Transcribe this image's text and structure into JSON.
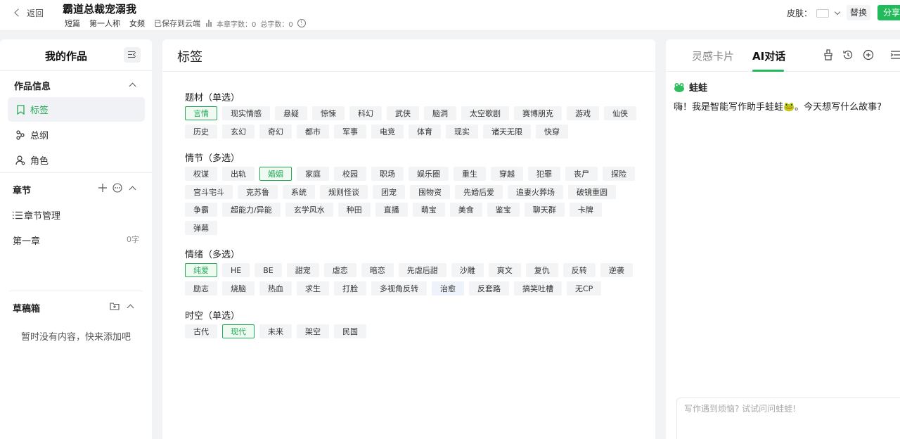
{
  "header": {
    "back_label": "返回",
    "title": "霸道总裁宠溺我",
    "tags": [
      "短篇",
      "第一人称",
      "女频"
    ],
    "saved_status": "已保存到云端",
    "chapter_count_label": "本章字数：0",
    "total_count_label": "总字数：0",
    "skin_label": "皮肤：",
    "replace_label": "替换",
    "share_label": "分享"
  },
  "sidebar": {
    "title": "我的作品",
    "work_info_title": "作品信息",
    "items": [
      {
        "label": "标签",
        "icon": "bookmark-icon",
        "active": true
      },
      {
        "label": "总纲",
        "icon": "outline-icon",
        "active": false
      },
      {
        "label": "角色",
        "icon": "person-icon",
        "active": false
      }
    ],
    "chapters_title": "章节",
    "chapter_manage_label": "章节管理",
    "chapters": [
      {
        "name": "第一章",
        "words": "0字"
      }
    ],
    "drafts_title": "草稿箱",
    "drafts_empty": "暂时没有内容，快来添加吧"
  },
  "main": {
    "title": "标签",
    "groups": [
      {
        "title": "题材（单选）",
        "rows": [
          [
            {
              "t": "言情",
              "s": true
            },
            {
              "t": "现实情感"
            },
            {
              "t": "悬疑"
            },
            {
              "t": "惊悚"
            },
            {
              "t": "科幻"
            },
            {
              "t": "武侠"
            },
            {
              "t": "脑洞"
            },
            {
              "t": "太空歌剧"
            },
            {
              "t": "赛博朋克"
            },
            {
              "t": "游戏"
            },
            {
              "t": "仙侠"
            }
          ],
          [
            {
              "t": "历史"
            },
            {
              "t": "玄幻"
            },
            {
              "t": "奇幻"
            },
            {
              "t": "都市"
            },
            {
              "t": "军事"
            },
            {
              "t": "电竞"
            },
            {
              "t": "体育"
            },
            {
              "t": "现实"
            },
            {
              "t": "诸天无限"
            },
            {
              "t": "快穿"
            }
          ]
        ]
      },
      {
        "title": "情节（多选）",
        "rows": [
          [
            {
              "t": "权谋"
            },
            {
              "t": "出轨"
            },
            {
              "t": "婚姻",
              "s": true
            },
            {
              "t": "家庭"
            },
            {
              "t": "校园"
            },
            {
              "t": "职场"
            },
            {
              "t": "娱乐圈"
            },
            {
              "t": "重生"
            },
            {
              "t": "穿越"
            },
            {
              "t": "犯罪"
            },
            {
              "t": "丧尸"
            },
            {
              "t": "探险"
            }
          ],
          [
            {
              "t": "宫斗宅斗"
            },
            {
              "t": "克苏鲁"
            },
            {
              "t": "系统"
            },
            {
              "t": "规则怪谈"
            },
            {
              "t": "团宠"
            },
            {
              "t": "囤物资"
            },
            {
              "t": "先婚后爱"
            },
            {
              "t": "追妻火葬场"
            },
            {
              "t": "破镜重圆"
            }
          ],
          [
            {
              "t": "争霸"
            },
            {
              "t": "超能力/异能"
            },
            {
              "t": "玄学风水"
            },
            {
              "t": "种田"
            },
            {
              "t": "直播"
            },
            {
              "t": "萌宝"
            },
            {
              "t": "美食"
            },
            {
              "t": "鉴宝"
            },
            {
              "t": "聊天群"
            },
            {
              "t": "卡牌"
            }
          ],
          [
            {
              "t": "弹幕"
            }
          ]
        ]
      },
      {
        "title": "情绪（多选）",
        "rows": [
          [
            {
              "t": "纯爱",
              "s": true
            },
            {
              "t": "HE"
            },
            {
              "t": "BE"
            },
            {
              "t": "甜宠"
            },
            {
              "t": "虐恋"
            },
            {
              "t": "暗恋"
            },
            {
              "t": "先虐后甜"
            },
            {
              "t": "沙雕"
            },
            {
              "t": "爽文"
            },
            {
              "t": "复仇"
            },
            {
              "t": "反转"
            },
            {
              "t": "逆袭"
            }
          ],
          [
            {
              "t": "励志"
            },
            {
              "t": "烧脑"
            },
            {
              "t": "热血"
            },
            {
              "t": "求生"
            },
            {
              "t": "打脸"
            },
            {
              "t": "多视角反转"
            },
            {
              "t": "治愈",
              "h": true
            },
            {
              "t": "反套路"
            },
            {
              "t": "搞笑吐槽"
            },
            {
              "t": "无CP"
            }
          ]
        ]
      },
      {
        "title": "时空（单选）",
        "rows": [
          [
            {
              "t": "古代"
            },
            {
              "t": "现代",
              "s": true
            },
            {
              "t": "未来"
            },
            {
              "t": "架空"
            },
            {
              "t": "民国"
            }
          ]
        ]
      }
    ]
  },
  "right": {
    "tab_cards": "灵感卡片",
    "tab_ai": "AI对话",
    "bot_name": "蛙蛙",
    "greeting": "嗨！我是智能写作助手蛙蛙🐸。今天想写什么故事?",
    "input_placeholder": "写作遇到烦恼? 试试问问蛙蛙!",
    "accent": "#22bb5c"
  }
}
